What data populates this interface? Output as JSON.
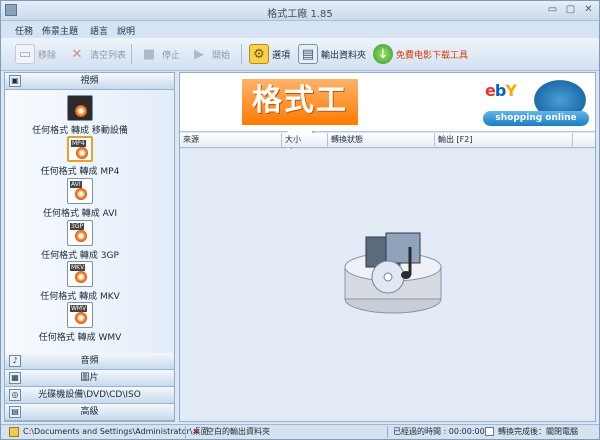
{
  "window": {
    "title": "格式工廠 1.85",
    "min": "▭",
    "max": "▢",
    "close": "✕"
  },
  "menu": [
    "任務",
    "佈景主題",
    "語言",
    "說明"
  ],
  "toolbar": {
    "remove": "移除",
    "clear": "清空列表",
    "stop": "停止",
    "start": "開始",
    "options": "選項",
    "output_folder": "輸出資料夾",
    "free_download": "免費电影下载工具"
  },
  "sidebar": {
    "top_category": "視頻",
    "formats": [
      {
        "label": "任何格式 轉成 移動設備",
        "tag": ""
      },
      {
        "label": "任何格式 轉成 MP4",
        "tag": "MP4"
      },
      {
        "label": "任何格式 轉成 AVI",
        "tag": "AVI"
      },
      {
        "label": "任何格式 轉成 3GP",
        "tag": "3GP"
      },
      {
        "label": "任何格式 轉成 MKV",
        "tag": "MKV"
      },
      {
        "label": "任何格式 轉成 WMV",
        "tag": "WMV"
      }
    ],
    "bottom_categories": [
      "音頻",
      "圖片",
      "光碟機設備\\DVD\\CD\\ISO",
      "高級"
    ]
  },
  "banner": {
    "title": "格式工厂",
    "ebay": "ebY",
    "shopping": "shopping online"
  },
  "table": {
    "columns": [
      "來源",
      "大小",
      "轉換狀態",
      "輸出 [F2]"
    ]
  },
  "statusbar": {
    "path": "C:\\Documents and Settings\\Administrator\\桌面",
    "empty_output": "空白的輸出資料夾",
    "elapsed_label": "已經過的時間 : 00:00:00",
    "after_done": "轉換完成後：關閉電腦"
  },
  "colors": {
    "accent": "#ff7a00",
    "panel": "#dbe6f3",
    "border": "#93aecb"
  }
}
